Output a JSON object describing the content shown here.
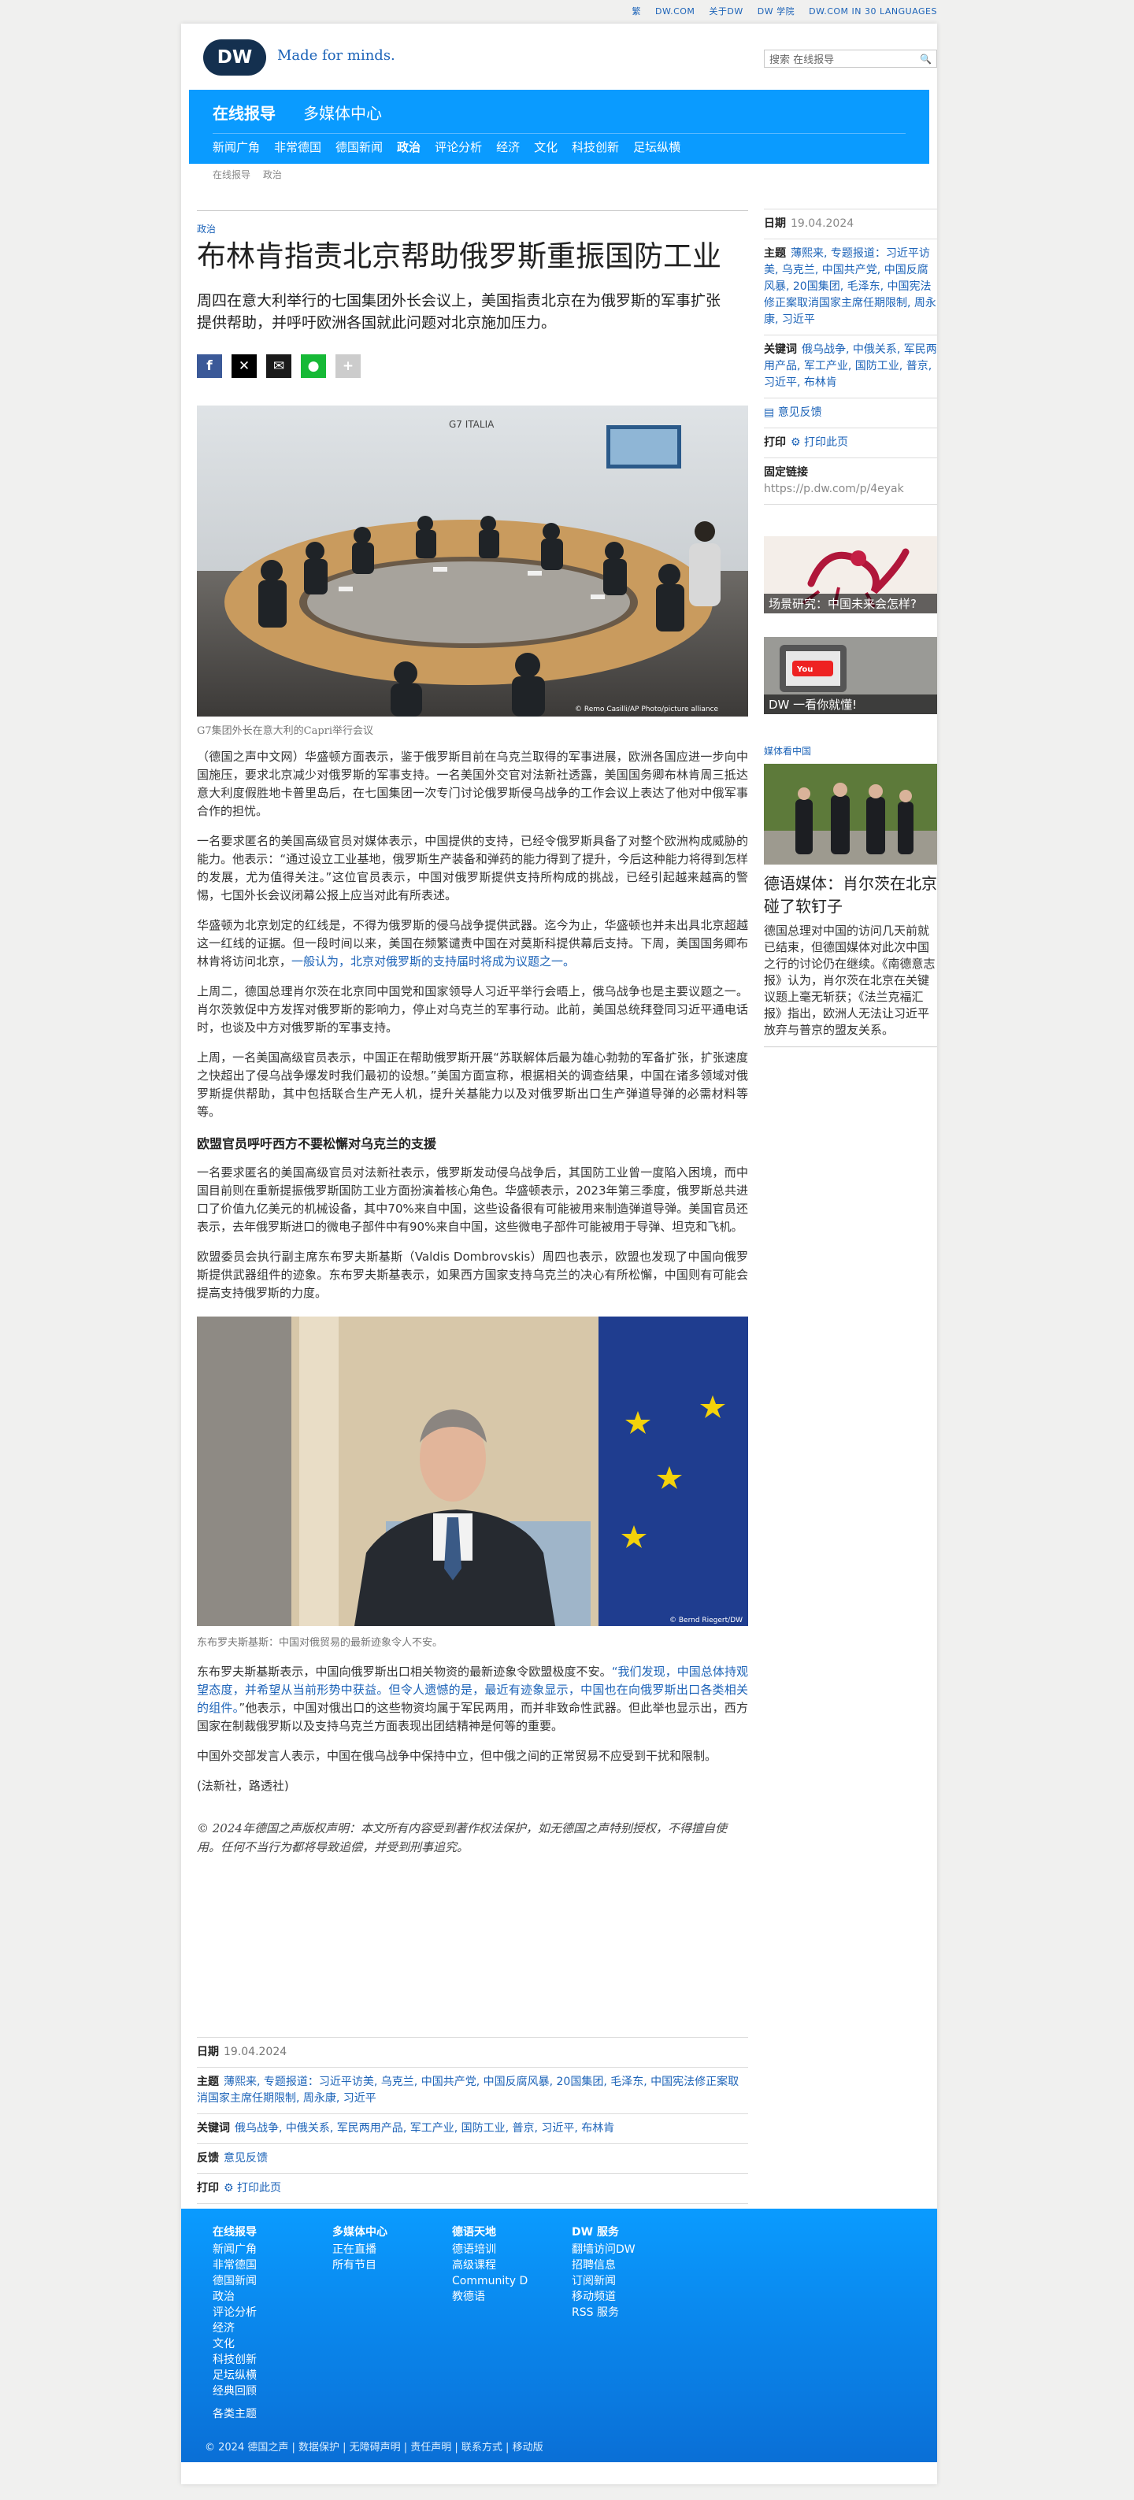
{
  "topbar": {
    "items": [
      "繁",
      "DW.COM",
      "关于DW",
      "DW 学院",
      "DW.COM IN 30 LANGUAGES"
    ]
  },
  "header": {
    "logo": "DW",
    "tagline": "Made for minds.",
    "search_placeholder": "搜索 在线报导"
  },
  "nav": {
    "title": "在线报导",
    "title2": "多媒体中心",
    "items": [
      "新闻广角",
      "非常德国",
      "德国新闻",
      "政治",
      "评论分析",
      "经济",
      "文化",
      "科技创新",
      "足坛纵横"
    ],
    "active_index": 3
  },
  "breadcrumb": [
    "在线报导",
    "政治"
  ],
  "article": {
    "kicker": "政治",
    "title": "布林肯指责北京帮助俄罗斯重振国防工业",
    "teaser": "周四在意大利举行的七国集团外长会议上，美国指责北京在为俄罗斯的军事扩张提供帮助，并呼吁欧洲各国就此问题对北京施加压力。",
    "image1_caption": "G7集团外长在意大利的Capri举行会议",
    "image1_credit": "© Remo Casilli/AP Photo/picture alliance",
    "image1_sign": "G7 ITALIA",
    "p1": "（德国之声中文网）华盛顿方面表示，鉴于俄罗斯目前在乌克兰取得的军事进展，欧洲各国应进一步向中国施压，要求北京减少对俄罗斯的军事支持。一名美国外交官对法新社透露，美国国务卿布林肯周三抵达意大利度假胜地卡普里岛后，在七国集团一次专门讨论俄罗斯侵乌战争的工作会议上表达了他对中俄军事合作的担忧。",
    "p2": "一名要求匿名的美国高级官员对媒体表示，中国提供的支持，已经令俄罗斯具备了对整个欧洲构成威胁的能力。他表示：“通过设立工业基地，俄罗斯生产装备和弹药的能力得到了提升，今后这种能力将得到怎样的发展，尤为值得关注。”这位官员表示，中国对俄罗斯提供支持所构成的挑战，已经引起越来越高的警惕，七国外长会议闭幕公报上应当对此有所表述。",
    "p3a": "华盛顿为北京划定的红线是，不得为俄罗斯的侵乌战争提供武器。迄今为止，华盛顿也并未出具北京超越这一红线的证据。但一段时间以来，美国在频繁谴责中国在对莫斯科提供幕后支持。下周，美国国务卿布林肯将访问北京，",
    "p3link": "一般认为，北京对俄罗斯的支持届时将成为议题之一。",
    "p4": "上周二，德国总理肖尔茨在北京同中国党和国家领导人习近平举行会晤上，俄乌战争也是主要议题之一。肖尔茨敦促中方发挥对俄罗斯的影响力，停止对乌克兰的军事行动。此前，美国总统拜登同习近平通电话时，也谈及中方对俄罗斯的军事支持。",
    "p5": "上周，一名美国高级官员表示，中国正在帮助俄罗斯开展“苏联解体后最为雄心勃勃的军备扩张，扩张速度之快超出了侵乌战争爆发时我们最初的设想。”美国方面宣称，根据相关的调查结果，中国在诸多领域对俄罗斯提供帮助，其中包括联合生产无人机，提升关基能力以及对俄罗斯出口生产弹道导弹的必需材料等等。",
    "h1": "欧盟官员呼吁西方不要松懈对乌克兰的支援",
    "p6": "一名要求匿名的美国高级官员对法新社表示，俄罗斯发动侵乌战争后，其国防工业曾一度陷入困境，而中国目前则在重新提振俄罗斯国防工业方面扮演着核心角色。华盛顿表示，2023年第三季度，俄罗斯总共进口了价值九亿美元的机械设备，其中70%来自中国，这些设备很有可能被用来制造弹道导弹。美国官员还表示，去年俄罗斯进口的微电子部件中有90%来自中国，这些微电子部件可能被用于导弹、坦克和飞机。",
    "p7": "欧盟委员会执行副主席东布罗夫斯基斯（Valdis Dombrovskis）周四也表示，欧盟也发现了中国向俄罗斯提供武器组件的迹象。东布罗夫斯基表示，如果西方国家支持乌克兰的决心有所松懈，中国则有可能会提高支持俄罗斯的力度。",
    "image2_caption": "东布罗夫斯基斯：中国对俄贸易的最新迹象令人不安。",
    "image2_credit": "© Bernd Riegert/DW",
    "p8a": "东布罗夫斯基斯表示，中国向俄罗斯出口相关物资的最新迹象令欧盟极度不安。",
    "p8link": "“我们发现，中国总体持观望态度，并希望从当前形势中获益。但令人遗憾的是，最近有迹象显示，中国也在向俄罗斯出口各类相关的组件。",
    "p8b": "”他表示，中国对俄出口的这些物资均属于军民两用，而并非致命性武器。但此举也显示出，西方国家在制裁俄罗斯以及支持乌克兰方面表现出团结精神是何等的重要。",
    "p9": "中国外交部发言人表示，中国在俄乌战争中保持中立，但中俄之间的正常贸易不应受到干扰和限制。",
    "p10": "(法新社，路透社)",
    "copyright": "© 2024年德国之声版权声明：本文所有内容受到著作权法保护，如无德国之声特别授权，不得擅自使用。任何不当行为都将导致追偿，并受到刑事追究。"
  },
  "meta": {
    "date_label": "日期",
    "date": "19.04.2024",
    "topics_label": "主题",
    "topics": "薄熙来, 专题报道：习近平访美, 乌克兰, 中国共产党, 中国反腐风暴, 20国集团, 毛泽东, 中国宪法修正案取消国家主席任期限制, 周永康, 习近平",
    "keywords_label": "关键词",
    "keywords": "俄乌战争, 中俄关系, 军民两用产品, 军工产业, 国防工业, 普京, 习近平, 布林肯",
    "feedback_label": "反馈",
    "feedback": "意见反馈",
    "print_label": "打印",
    "print": "打印此页",
    "link_label": "固定链接",
    "link": "https://p.dw.com/p/4eyak"
  },
  "sidebar": {
    "feedback": "意见反馈",
    "promo1": "场景研究：中国未来会怎样?",
    "promo2": "DW 一看你就懂!",
    "media_head": "媒体看中国",
    "media_title": "德语媒体：肖尔茨在北京碰了软钉子",
    "media_text": "德国总理对中国的访问几天前就已结束，但德国媒体对此次中国之行的讨论仍在继续。《南德意志报》认为，肖尔茨在北京在关键议题上毫无斩获；《法兰克福汇报》指出，欧洲人无法让习近平放弃与普京的盟友关系。"
  },
  "footer": {
    "columns": [
      {
        "head": "在线报导",
        "items": [
          "新闻广角",
          "非常德国",
          "德国新闻",
          "政治",
          "评论分析",
          "经济",
          "文化",
          "科技创新",
          "足坛纵横",
          "经典回顾"
        ]
      },
      {
        "head": "多媒体中心",
        "items": [
          "正在直播",
          "所有节目"
        ]
      },
      {
        "head": "德语天地",
        "items": [
          "德语培训",
          "高级课程",
          "Community D",
          "教德语"
        ]
      },
      {
        "head": "DW 服务",
        "items": [
          "翻墙访问DW",
          "招聘信息",
          "订阅新闻",
          "移动频道",
          "RSS 服务"
        ]
      }
    ],
    "bottom": "各类主题",
    "copy": "© 2024 德国之声 | 数据保护 | 无障碍声明 | 责任声明 | 联系方式 | 移动版"
  },
  "colors": {
    "accent": "#0a9bff",
    "link": "#1c63b8",
    "logo": "#14304f"
  }
}
